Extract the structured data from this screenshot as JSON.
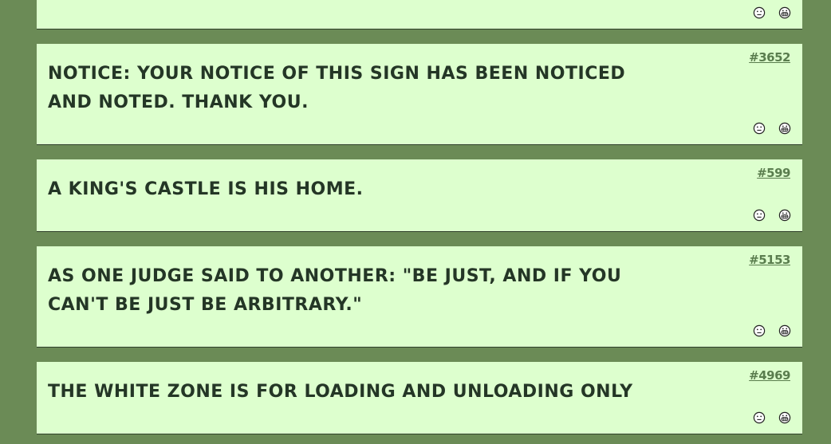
{
  "quotes": [
    {
      "id": "",
      "text": "",
      "vote_up_icon": "smiley-face-icon",
      "vote_down_icon": "grimace-face-icon"
    },
    {
      "id": "#3652",
      "text": "Notice: Your notice of this sign has been noticed and noted. Thank you.",
      "vote_up_icon": "smiley-face-icon",
      "vote_down_icon": "grimace-face-icon"
    },
    {
      "id": "#599",
      "text": "A king's castle is his home.",
      "vote_up_icon": "smiley-face-icon",
      "vote_down_icon": "grimace-face-icon"
    },
    {
      "id": "#5153",
      "text": "As one judge said to another: \"Be just, and if you can't be just be arbitrary.\"",
      "vote_up_icon": "smiley-face-icon",
      "vote_down_icon": "grimace-face-icon"
    },
    {
      "id": "#4969",
      "text": "The white zone is for loading and unloading only",
      "vote_up_icon": "smiley-face-icon",
      "vote_down_icon": "grimace-face-icon"
    }
  ],
  "colors": {
    "page_background": "#6b8b56",
    "card_background": "#ddffce",
    "quote_text": "#243626",
    "quote_id_link": "#5a7d4e"
  }
}
